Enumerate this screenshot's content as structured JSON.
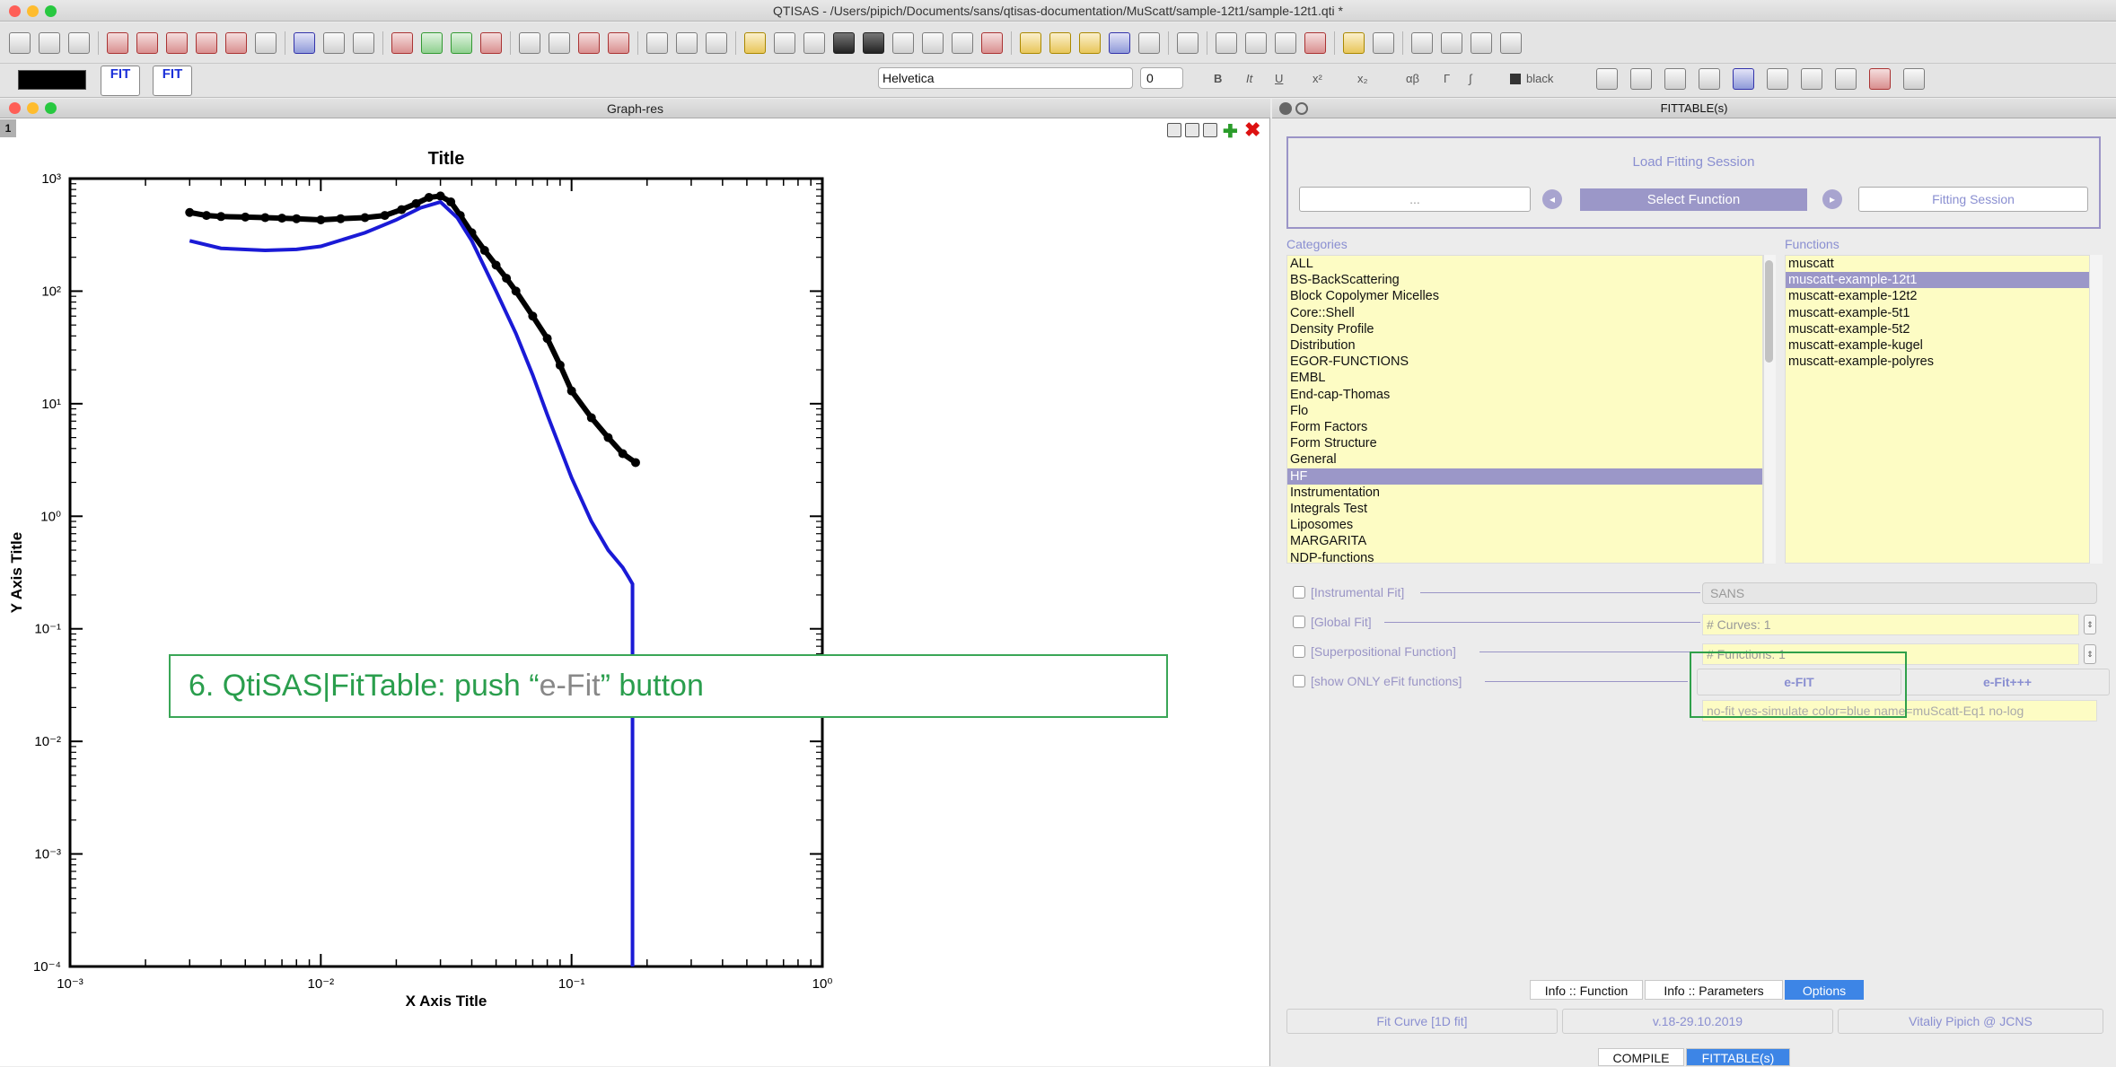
{
  "window": {
    "title": "QTISAS - /Users/pipich/Documents/sans/qtisas-documentation/MuScatt/sample-12t1/sample-12t1.qti *"
  },
  "toolbar": {
    "fit_label_1": "FIT",
    "fit_label_2": "FIT",
    "font_family": "Helvetica",
    "font_size": "0",
    "bold": "B",
    "italic": "It",
    "underline": "U",
    "superscript": "x²",
    "subscript": "x₂",
    "greek": "αβ",
    "gamma": "Γ",
    "integral": "∫",
    "text_color": "black"
  },
  "graph": {
    "window_title": "Graph-res",
    "layer": "1",
    "title": "Title",
    "xlabel": "X Axis Title",
    "ylabel": "Y Axis Title",
    "x_ticks": [
      "10⁻³",
      "10⁻²",
      "10⁻¹",
      "10⁰"
    ],
    "y_ticks": [
      "10³",
      "10²",
      "10¹",
      "10⁰",
      "10⁻¹",
      "10⁻²",
      "10⁻³",
      "10⁻⁴"
    ]
  },
  "chart_data": {
    "type": "scatter",
    "title": "Title",
    "xlabel": "X Axis Title",
    "ylabel": "Y Axis Title",
    "xscale": "log",
    "yscale": "log",
    "xlim": [
      0.001,
      1
    ],
    "ylim": [
      0.0001,
      1000
    ],
    "series": [
      {
        "style": "points",
        "color": "#000000",
        "x": [
          0.003,
          0.0035,
          0.004,
          0.005,
          0.006,
          0.007,
          0.008,
          0.01,
          0.012,
          0.015,
          0.018,
          0.021,
          0.024,
          0.027,
          0.03,
          0.033,
          0.036,
          0.04,
          0.045,
          0.05,
          0.055,
          0.06,
          0.07,
          0.08,
          0.09,
          0.1,
          0.12,
          0.14,
          0.16,
          0.18
        ],
        "y": [
          500,
          470,
          460,
          455,
          450,
          445,
          440,
          430,
          440,
          450,
          470,
          530,
          600,
          680,
          700,
          620,
          470,
          330,
          230,
          170,
          130,
          100,
          60,
          38,
          22,
          13,
          7.5,
          5,
          3.6,
          3
        ]
      },
      {
        "style": "line",
        "color": "#1a1ad6",
        "x": [
          0.003,
          0.004,
          0.006,
          0.008,
          0.01,
          0.015,
          0.02,
          0.025,
          0.03,
          0.035,
          0.04,
          0.05,
          0.06,
          0.07,
          0.08,
          0.1,
          0.12,
          0.14,
          0.16,
          0.17,
          0.175,
          0.175
        ],
        "y": [
          280,
          240,
          230,
          235,
          250,
          330,
          430,
          550,
          620,
          450,
          280,
          100,
          42,
          18,
          8,
          2.2,
          0.9,
          0.5,
          0.35,
          0.28,
          0.25,
          0.0001
        ]
      }
    ]
  },
  "callout": {
    "text_prefix": "6. QtiSAS|FitTable: push “",
    "text_quoted": "e-Fit",
    "text_suffix": "” button"
  },
  "fittable": {
    "window_title": "FITTABLE(s)",
    "load_session": "Load Fitting Session",
    "session_input_placeholder": "...",
    "select_function": "Select Function",
    "fitting_session": "Fitting Session",
    "categories_label": "Categories",
    "functions_label": "Functions",
    "categories": [
      "ALL",
      "BS-BackScattering",
      "Block Copolymer Micelles",
      "Core::Shell",
      "Density Profile",
      "Distribution",
      "EGOR-FUNCTIONS",
      "EMBL",
      "End-cap-Thomas",
      "Flo",
      "Form Factors",
      "Form Structure",
      "General",
      "HF",
      "Instrumentation",
      "Integrals Test",
      "Liposomes",
      "MARGARITA",
      "NDP-functions"
    ],
    "selected_category": "HF",
    "functions": [
      "muscatt",
      "muscatt-example-12t1",
      "muscatt-example-12t2",
      "muscatt-example-5t1",
      "muscatt-example-5t2",
      "muscatt-example-kugel",
      "muscatt-example-polyres"
    ],
    "selected_function": "muscatt-example-12t1",
    "options": {
      "instrumental_fit": "[Instrumental Fit]",
      "global_fit": "[Global Fit]",
      "superpositional": "[Superpositional Function]",
      "efit_only": "[show ONLY eFit functions]",
      "instrument": "SANS",
      "curves": "# Curves:  1",
      "functions": "# Functions:  1",
      "efit_btn": "e-FIT",
      "efitplus_btn": "e-Fit+++",
      "efit_text": "no-fit yes-simulate color=blue name=muScatt-Eq1 no-log"
    },
    "tabs": [
      "Info :: Function",
      "Info :: Parameters",
      "Options"
    ],
    "active_tab": "Options",
    "fit_curve": "Fit Curve [1D fit]",
    "version": "v.18-29.10.2019",
    "author": "Vitaliy Pipich @ JCNS",
    "bottom_tabs": [
      "COMPILE",
      "FITTABLE(s)"
    ]
  }
}
